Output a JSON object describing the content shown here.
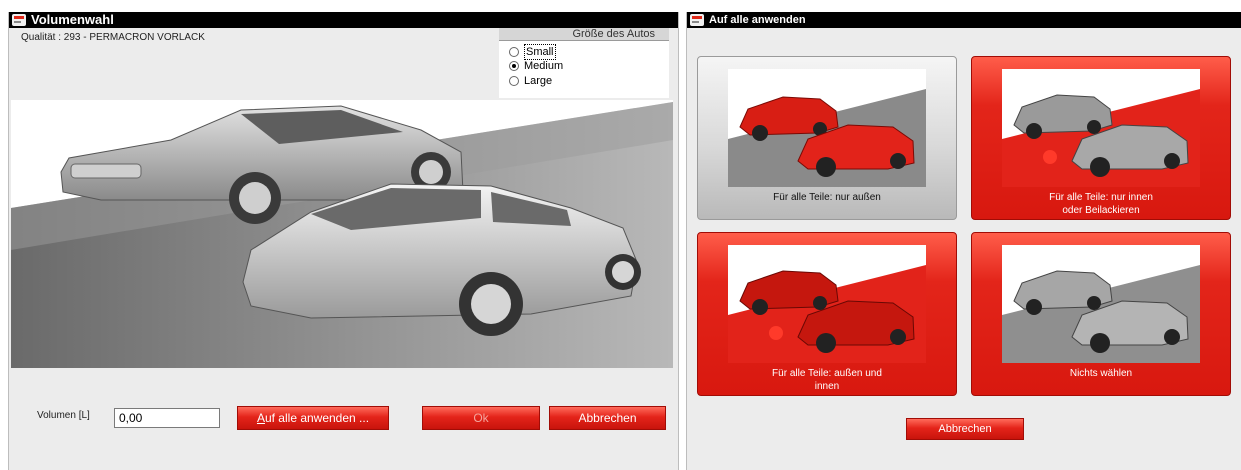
{
  "left_window": {
    "title": "Volumenwahl",
    "quality_text": "Qualität : 293 - PERMACRON VORLACK",
    "size_group": {
      "legend": "Größe des Autos",
      "options": [
        {
          "label": "Small",
          "checked": false
        },
        {
          "label": "Medium",
          "checked": true
        },
        {
          "label": "Large",
          "checked": false
        }
      ]
    },
    "volume_label": "Volumen [L]",
    "volume_value": "0,00",
    "buttons": {
      "apply_all": "Auf alle anwenden ...",
      "ok": "Ok",
      "cancel": "Abbrechen"
    }
  },
  "right_window": {
    "title": "Auf alle anwenden",
    "options": [
      {
        "caption_line1": "Für alle Teile: nur außen",
        "caption_line2": "",
        "style": "gray"
      },
      {
        "caption_line1": "Für alle Teile: nur innen",
        "caption_line2": "oder Beilackieren",
        "style": "red"
      },
      {
        "caption_line1": "Für alle Teile: außen und",
        "caption_line2": "innen",
        "style": "red"
      },
      {
        "caption_line1": "Nichts wählen",
        "caption_line2": "",
        "style": "red"
      }
    ],
    "cancel": "Abbrechen"
  },
  "colors": {
    "brand_red": "#e2231a",
    "titlebar": "#000000",
    "window_bg": "#ececec"
  }
}
